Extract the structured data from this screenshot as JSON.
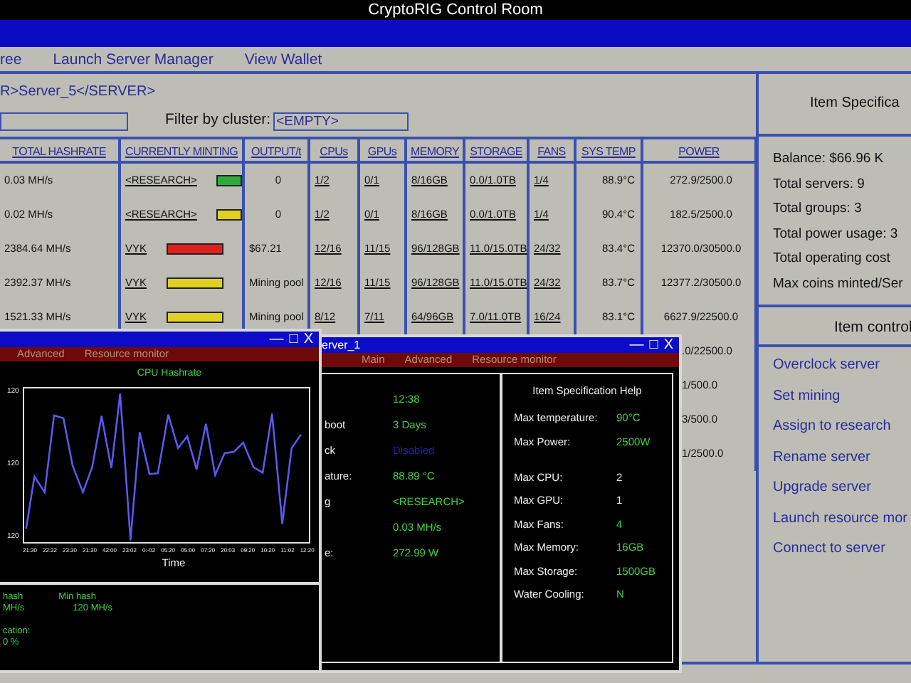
{
  "window": {
    "title": "CryptoRIG Control Room"
  },
  "menu": [
    {
      "label": "ree"
    },
    {
      "label": "Launch Server Manager"
    },
    {
      "label": "View Wallet"
    }
  ],
  "breadcrumb": "R>Server_5</SERVER>",
  "filter": {
    "label": "Filter by cluster:",
    "value": "<EMPTY>"
  },
  "table": {
    "columns": [
      "TOTAL HASHRATE",
      "CURRENTLY MINTING",
      "OUTPUT/t",
      "CPUs",
      "GPUs",
      "MEMORY",
      "STORAGE",
      "FANS",
      "SYS TEMP",
      "POWER"
    ],
    "rows": [
      {
        "kind": "full",
        "hashrate": "0.03 MH/s",
        "minting": "<RESEARCH>",
        "color": "#2eaa3a",
        "output": "0",
        "cpus": "1/2",
        "gpus": "0/1",
        "memory": "8/16GB",
        "storage": "0.0/1.0TB",
        "fans": "1/4",
        "temp": "88.9°C",
        "power": "272.9/2500.0"
      },
      {
        "kind": "full",
        "hashrate": "0.02 MH/s",
        "minting": "<RESEARCH>",
        "color": "#e0d020",
        "output": "0",
        "cpus": "1/2",
        "gpus": "0/1",
        "memory": "8/16GB",
        "storage": "0.0/1.0TB",
        "fans": "1/4",
        "temp": "90.4°C",
        "power": "182.5/2500.0"
      },
      {
        "kind": "full",
        "hashrate": "2384.64 MH/s",
        "minting": "VYK",
        "color": "#e02020",
        "output": "$67.21",
        "cpus": "12/16",
        "gpus": "11/15",
        "memory": "96/128GB",
        "storage": "11.0/15.0TB",
        "fans": "24/32",
        "temp": "83.4°C",
        "power": "12370.0/30500.0"
      },
      {
        "kind": "full",
        "hashrate": "2392.37 MH/s",
        "minting": "VYK",
        "color": "#e0d020",
        "output": "Mining pool",
        "cpus": "12/16",
        "gpus": "11/15",
        "memory": "96/128GB",
        "storage": "11.0/15.0TB",
        "fans": "24/32",
        "temp": "83.7°C",
        "power": "12377.2/30500.0"
      },
      {
        "kind": "full",
        "hashrate": "1521.33 MH/s",
        "minting": "VYK",
        "color": "#e0d020",
        "output": "Mining pool",
        "cpus": "8/12",
        "gpus": "7/11",
        "memory": "64/96GB",
        "storage": "7.0/11.0TB",
        "fans": "16/24",
        "temp": "83.1°C",
        "power": "6627.9/22500.0"
      },
      {
        "kind": "partial",
        "power": ".0/22500.0"
      },
      {
        "kind": "partial",
        "power": "1/500.0"
      },
      {
        "kind": "partial",
        "power": "3/500.0"
      },
      {
        "kind": "partial",
        "power": "1/2500.0"
      }
    ]
  },
  "side_panel": {
    "title": "Item Specifica",
    "stats": [
      "Balance: $66.96 K",
      "Total servers: 9",
      "Total groups: 3",
      "Total power usage: 3",
      "Total operating cost",
      "Max coins minted/Ser"
    ],
    "control_title": "Item control",
    "actions": [
      "Overclock server",
      "Set mining",
      "Assign to research",
      "Rename server",
      "Upgrade server",
      "Launch resource mor",
      "Connect to server"
    ]
  },
  "windows": [
    {
      "kind": "spec",
      "title": "erver_1",
      "controls": [
        "—",
        "□",
        "X"
      ],
      "tabs": [
        "Main",
        "Advanced",
        "Resource monitor"
      ],
      "fields": [
        {
          "value": "12:38",
          "color": "#3ed23e"
        },
        {
          "label": "boot",
          "value": "3 Days",
          "color": "#3ed23e"
        },
        {
          "label": "ck",
          "value": "Disabled",
          "color": "#2020b0"
        },
        {
          "label": "ature:",
          "value": "88.89 °C",
          "color": "#3ed23e"
        },
        {
          "label": "g",
          "value": "<RESEARCH>",
          "color": "#3ed23e"
        },
        {
          "value": "0.03 MH/s",
          "color": "#3ed23e"
        },
        {
          "label": "e:",
          "value": "272.99 W",
          "color": "#3ed23e"
        }
      ],
      "help_title": "Item Specification Help",
      "help": [
        {
          "label": "Max temperature:",
          "value": "90°C",
          "color": "#3ed23e"
        },
        {
          "label": "Max Power:",
          "value": "2500W",
          "color": "#3ed23e"
        },
        {
          "label": "Max CPU:",
          "value": "2",
          "color": "#eeeeee"
        },
        {
          "label": "Max GPU:",
          "value": "1",
          "color": "#eeeeee"
        },
        {
          "label": "Max Fans:",
          "value": "4",
          "color": "#3ed23e"
        },
        {
          "label": "Max Memory:",
          "value": "16GB",
          "color": "#3ed23e"
        },
        {
          "label": "Max Storage:",
          "value": "1500GB",
          "color": "#3ed23e"
        },
        {
          "label": "Water Cooling:",
          "value": "N",
          "color": "#3ed23e"
        }
      ]
    },
    {
      "kind": "monitor",
      "controls": [
        "—",
        "□",
        "X"
      ],
      "tabs": [
        "Advanced",
        "Resource monitor"
      ],
      "chart_title": "CPU Hashrate",
      "y_labels": [
        "120",
        "120",
        "120"
      ],
      "x_labels": [
        "21:30",
        "22:32",
        "23:30",
        "21:30",
        "42:00",
        "23:02",
        "0:-02",
        "05:20",
        "05:00",
        "07:20",
        "20:03",
        "09:20",
        "10:20",
        "11:02",
        "12:20"
      ],
      "x_title": "Time",
      "stats": [
        {
          "label": "hash",
          "value": "MH/s"
        },
        {
          "label": "Min hash",
          "value": "120 MH/s"
        },
        {
          "label": "cation:",
          "value": "0 %"
        }
      ]
    }
  ]
}
